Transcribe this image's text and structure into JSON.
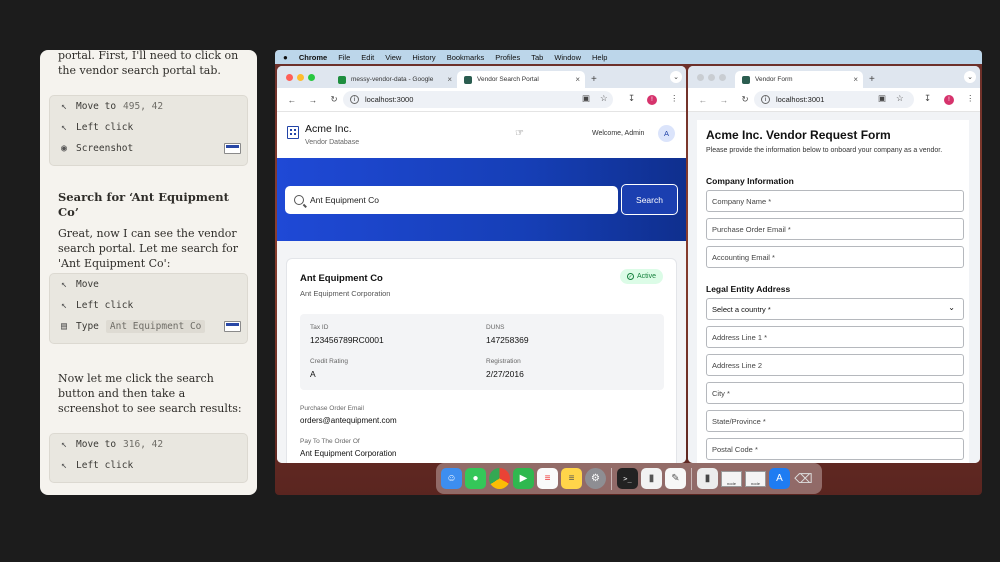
{
  "assistant": {
    "msg0": "portal. First, I'll need to click on the vendor search portal tab.",
    "card1": [
      {
        "icon": "cursor-icon",
        "action": "Move to",
        "arg": "495, 42"
      },
      {
        "icon": "click-icon",
        "action": "Left click",
        "arg": ""
      },
      {
        "icon": "camera-icon",
        "action": "Screenshot",
        "arg": ""
      }
    ],
    "msg1_title": "Search for ‘Ant Equipment Co’",
    "msg1_body": "Great, now I can see the vendor search portal. Let me search for 'Ant Equipment Co':",
    "card2": [
      {
        "icon": "cursor-icon",
        "action": "Move",
        "arg": ""
      },
      {
        "icon": "click-icon",
        "action": "Left click",
        "arg": ""
      },
      {
        "icon": "keyboard-icon",
        "action": "Type",
        "arg": "Ant Equipment Co"
      }
    ],
    "msg2_body": "Now let me click the search button and then take a screenshot to see search results:",
    "card3": [
      {
        "icon": "cursor-icon",
        "action": "Move to",
        "arg": "316, 42"
      },
      {
        "icon": "click-icon",
        "action": "Left click",
        "arg": ""
      }
    ]
  },
  "menubar": {
    "apple": "",
    "items": [
      "Chrome",
      "File",
      "Edit",
      "View",
      "History",
      "Bookmarks",
      "Profiles",
      "Tab",
      "Window",
      "Help"
    ]
  },
  "window1": {
    "tabs": [
      {
        "title": "messy-vendor-data - Google",
        "favicon_color": "#1e8e3e"
      },
      {
        "title": "Vendor Search Portal",
        "favicon_color": "#2b5d50"
      }
    ],
    "url": "localhost:3000",
    "app": {
      "company": "Acme Inc.",
      "subtitle": "Vendor Database",
      "welcome": "Welcome, Admin",
      "avatar": "A",
      "search_value": "Ant Equipment Co",
      "search_button": "Search"
    },
    "result": {
      "name": "Ant Equipment Co",
      "legal_name": "Ant Equipment Corporation",
      "status": "Active",
      "tax_id_label": "Tax ID",
      "tax_id": "123456789RC0001",
      "duns_label": "DUNS",
      "duns": "147258369",
      "credit_label": "Credit Rating",
      "credit": "A",
      "reg_label": "Registration",
      "reg": "2/27/2016",
      "po_email_label": "Purchase Order Email",
      "po_email": "orders@antequipment.com",
      "pay_to_label": "Pay To The Order Of",
      "pay_to": "Ant Equipment Corporation"
    }
  },
  "window2": {
    "tabs": [
      {
        "title": "Vendor Form",
        "favicon_color": "#2b5d50"
      }
    ],
    "url": "localhost:3001",
    "form": {
      "title": "Acme Inc. Vendor Request Form",
      "desc": "Please provide the information below to onboard your company as a vendor.",
      "company_section": "Company Information",
      "company_name": "Company Name *",
      "po_email": "Purchase Order Email *",
      "accounting_email": "Accounting Email *",
      "address_section": "Legal Entity Address",
      "country": "Select a country *",
      "address1": "Address Line 1 *",
      "address2": "Address Line 2",
      "city": "City *",
      "state": "State/Province *",
      "postal": "Postal Code *"
    }
  },
  "dock": {
    "apps": [
      "finder-icon",
      "messages-icon",
      "chrome-icon",
      "facetime-icon",
      "reminders-icon",
      "notes-icon",
      "settings-icon",
      "terminal-icon",
      "file-icon",
      "textedit-icon",
      "document-icon",
      "screenshot-thumb",
      "screenshot-thumb",
      "appstore-icon",
      "trash-icon"
    ],
    "thumb_label": "node"
  }
}
